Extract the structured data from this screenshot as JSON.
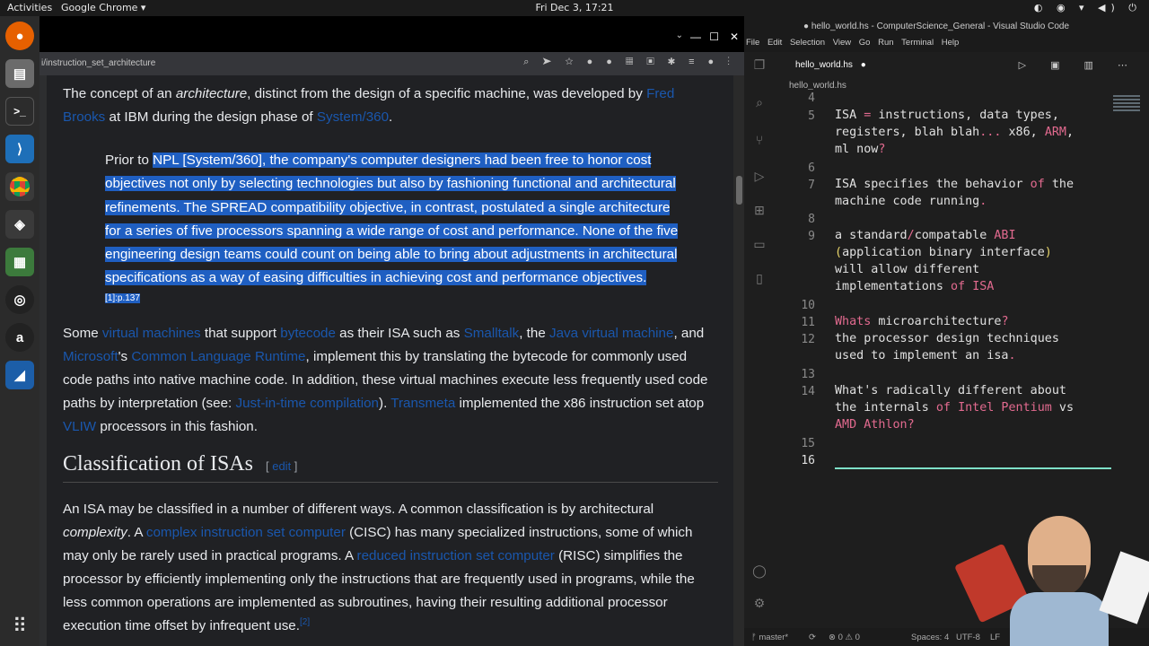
{
  "topbar": {
    "activities": "Activities",
    "app": "Google Chrome ▾",
    "clock": "Fri Dec  3, 17:21",
    "tray": "◐ ◉ ▾ ◀) ⏻"
  },
  "chrome": {
    "url": "i/instruction_set_architecture",
    "win_min": "—",
    "win_max": "☐",
    "win_close": "✕",
    "tab_dropdown": "⌄",
    "toolbar_icons": "⌕ ➤ ☆ ● ● ▦ ▣ ✱ ≡ ● ⋮"
  },
  "article": {
    "p1_a": "The concept of an ",
    "p1_em": "architecture",
    "p1_b": ", distinct from the design of a specific machine, was developed by ",
    "p1_link1": "Fred Brooks",
    "p1_c": " at IBM during the design phase of ",
    "p1_link2": "System/360",
    "p1_d": ".",
    "quote_lead": "Prior to ",
    "quote_highlight": "NPL [System/360], the company's computer designers had been free to honor cost objectives not only by selecting technologies but also by fashioning functional and architectural refinements. The SPREAD compatibility objective, in contrast, postulated a single architecture for a series of five processors spanning a wide range of cost and performance. None of the five engineering design teams could count on being able to bring about adjustments in architectural specifications as a way of easing difficulties in achieving cost and performance objectives.",
    "quote_ref": "[1]:p.137",
    "p2_a": "Some ",
    "p2_link1": "virtual machines",
    "p2_b": " that support ",
    "p2_link2": "bytecode",
    "p2_c": " as their ISA such as ",
    "p2_link3": "Smalltalk",
    "p2_d": ", the ",
    "p2_link4": "Java virtual machine",
    "p2_e": ", and ",
    "p2_link5": "Microsoft",
    "p2_f": "'s ",
    "p2_link6": "Common Language Runtime",
    "p2_g": ", implement this by translating the bytecode for commonly used code paths into native machine code. In addition, these virtual machines execute less frequently used code paths by interpretation (see: ",
    "p2_link7": "Just-in-time compilation",
    "p2_h": "). ",
    "p2_link8": "Transmeta",
    "p2_i": " implemented the x86 instruction set atop ",
    "p2_link9": "VLIW",
    "p2_j": " processors in this fashion.",
    "heading": "Classification of ISAs",
    "edit_open": "[ ",
    "edit_label": "edit",
    "edit_close": " ]",
    "p3_a": "An ISA may be classified in a number of different ways. A common classification is by architectural ",
    "p3_em": "complexity",
    "p3_b": ". A ",
    "p3_link1": "complex instruction set computer",
    "p3_c": " (CISC) has many specialized instructions, some of which may only be rarely used in practical programs. A ",
    "p3_link2": "reduced instruction set computer",
    "p3_d": " (RISC) simplifies the processor by efficiently implementing only the instructions that are frequently used in programs, while the less common operations are implemented as subroutines, having their resulting additional processor execution time offset by infrequent use.",
    "p3_ref": "[2]"
  },
  "vscode": {
    "title": "● hello_world.hs - ComputerScience_General - Visual Studio Code",
    "menu": [
      "File",
      "Edit",
      "Selection",
      "View",
      "Go",
      "Run",
      "Terminal",
      "Help"
    ],
    "tab": "hello_world.hs",
    "tab_dot": "●",
    "breadcrumb": "hello_world.hs",
    "tab_icons": "▷ ▣ ▥ ⋯",
    "line_numbers": {
      "l4": "4",
      "l5": "5",
      "l6": "6",
      "l7": "7",
      "l8": "8",
      "l9": "9",
      "l10": "10",
      "l11": "11",
      "l12": "12",
      "l13": "13",
      "l14": "14",
      "l15": "15",
      "l16": "16"
    },
    "code": {
      "l5a_1": "ISA ",
      "l5a_2": "=",
      "l5a_3": " instructions, data types,",
      "l5b_1": "registers, blah blah",
      "l5b_2": "...",
      "l5b_3": " x86, ",
      "l5b_4": "ARM",
      "l5b_5": ",",
      "l5c_1": "ml now",
      "l5c_2": "?",
      "l7a_1": "ISA",
      "l7a_2": " specifies the behavior ",
      "l7a_3": "of",
      "l7a_4": " the",
      "l7b_1": "machine code running",
      "l7b_2": ".",
      "l9a_1": "a standard",
      "l9a_2": "/",
      "l9a_3": "compatable ",
      "l9a_4": "ABI",
      "l9b_1": "(",
      "l9b_2": "application binary interface",
      "l9b_3": ")",
      "l9c": "will allow different",
      "l9d_1": "implementations ",
      "l9d_2": "of",
      "l9d_3": " ",
      "l9d_4": "ISA",
      "l11_1": "Whats",
      "l11_2": " microarchitecture",
      "l11_3": "?",
      "l12": "the processor design techniques",
      "l12b_1": "used to implement an isa",
      "l12b_2": ".",
      "l14a_1": "What's",
      "l14a_2": " radically different about",
      "l14b_1": "the internals ",
      "l14b_2": "of",
      "l14b_3": " ",
      "l14b_4": "Intel Pentium",
      "l14b_5": " vs",
      "l14c_1": "AMD Athlon",
      "l14c_2": "?"
    },
    "status": {
      "branch": "ᚠ master*",
      "sync": "⟳",
      "problems": "⊗ 0 ⚠ 0",
      "spaces": "Spaces: 4",
      "encoding": "UTF-8",
      "eol": "LF"
    }
  },
  "colors": {
    "highlight": "#1f5fc2",
    "link": "#1a57ad",
    "keyword": "#e26a8f",
    "string": "#e8d56a",
    "cursor_line": "#7ee0c8"
  }
}
